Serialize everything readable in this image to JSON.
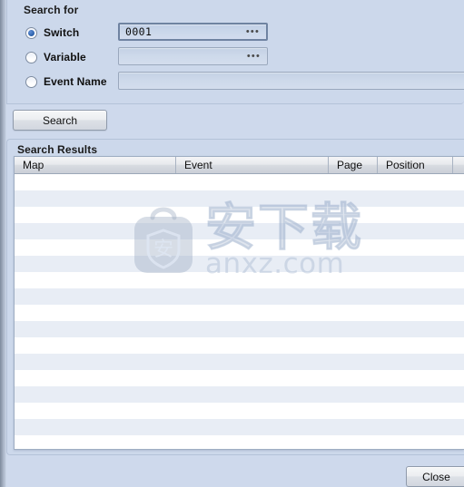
{
  "search_for": {
    "title": "Search for",
    "options": [
      {
        "id": "switch",
        "label": "Switch",
        "selected": true,
        "value": "0001",
        "has_browse": true
      },
      {
        "id": "variable",
        "label": "Variable",
        "selected": false,
        "value": "",
        "has_browse": true
      },
      {
        "id": "event_name",
        "label": "Event Name",
        "selected": false,
        "value": "",
        "has_browse": false
      }
    ],
    "browse_glyph": "•••",
    "search_button_label": "Search"
  },
  "results": {
    "title": "Search Results",
    "columns": [
      "Map",
      "Event",
      "Page",
      "Position"
    ],
    "rows": []
  },
  "footer": {
    "close_label": "Close"
  },
  "watermark": {
    "cn_text": "安下载",
    "en_text": "anxz.com",
    "logo_char": "安"
  },
  "colors": {
    "dialog_bg": "#ced9ec",
    "group_bg": "#ccd8eb",
    "field_bg": "#ced9ea",
    "radio_dot": "#2a5fa8",
    "row_even": "#e8edf5",
    "row_odd": "#ffffff",
    "header_border": "#9ba7b8"
  }
}
